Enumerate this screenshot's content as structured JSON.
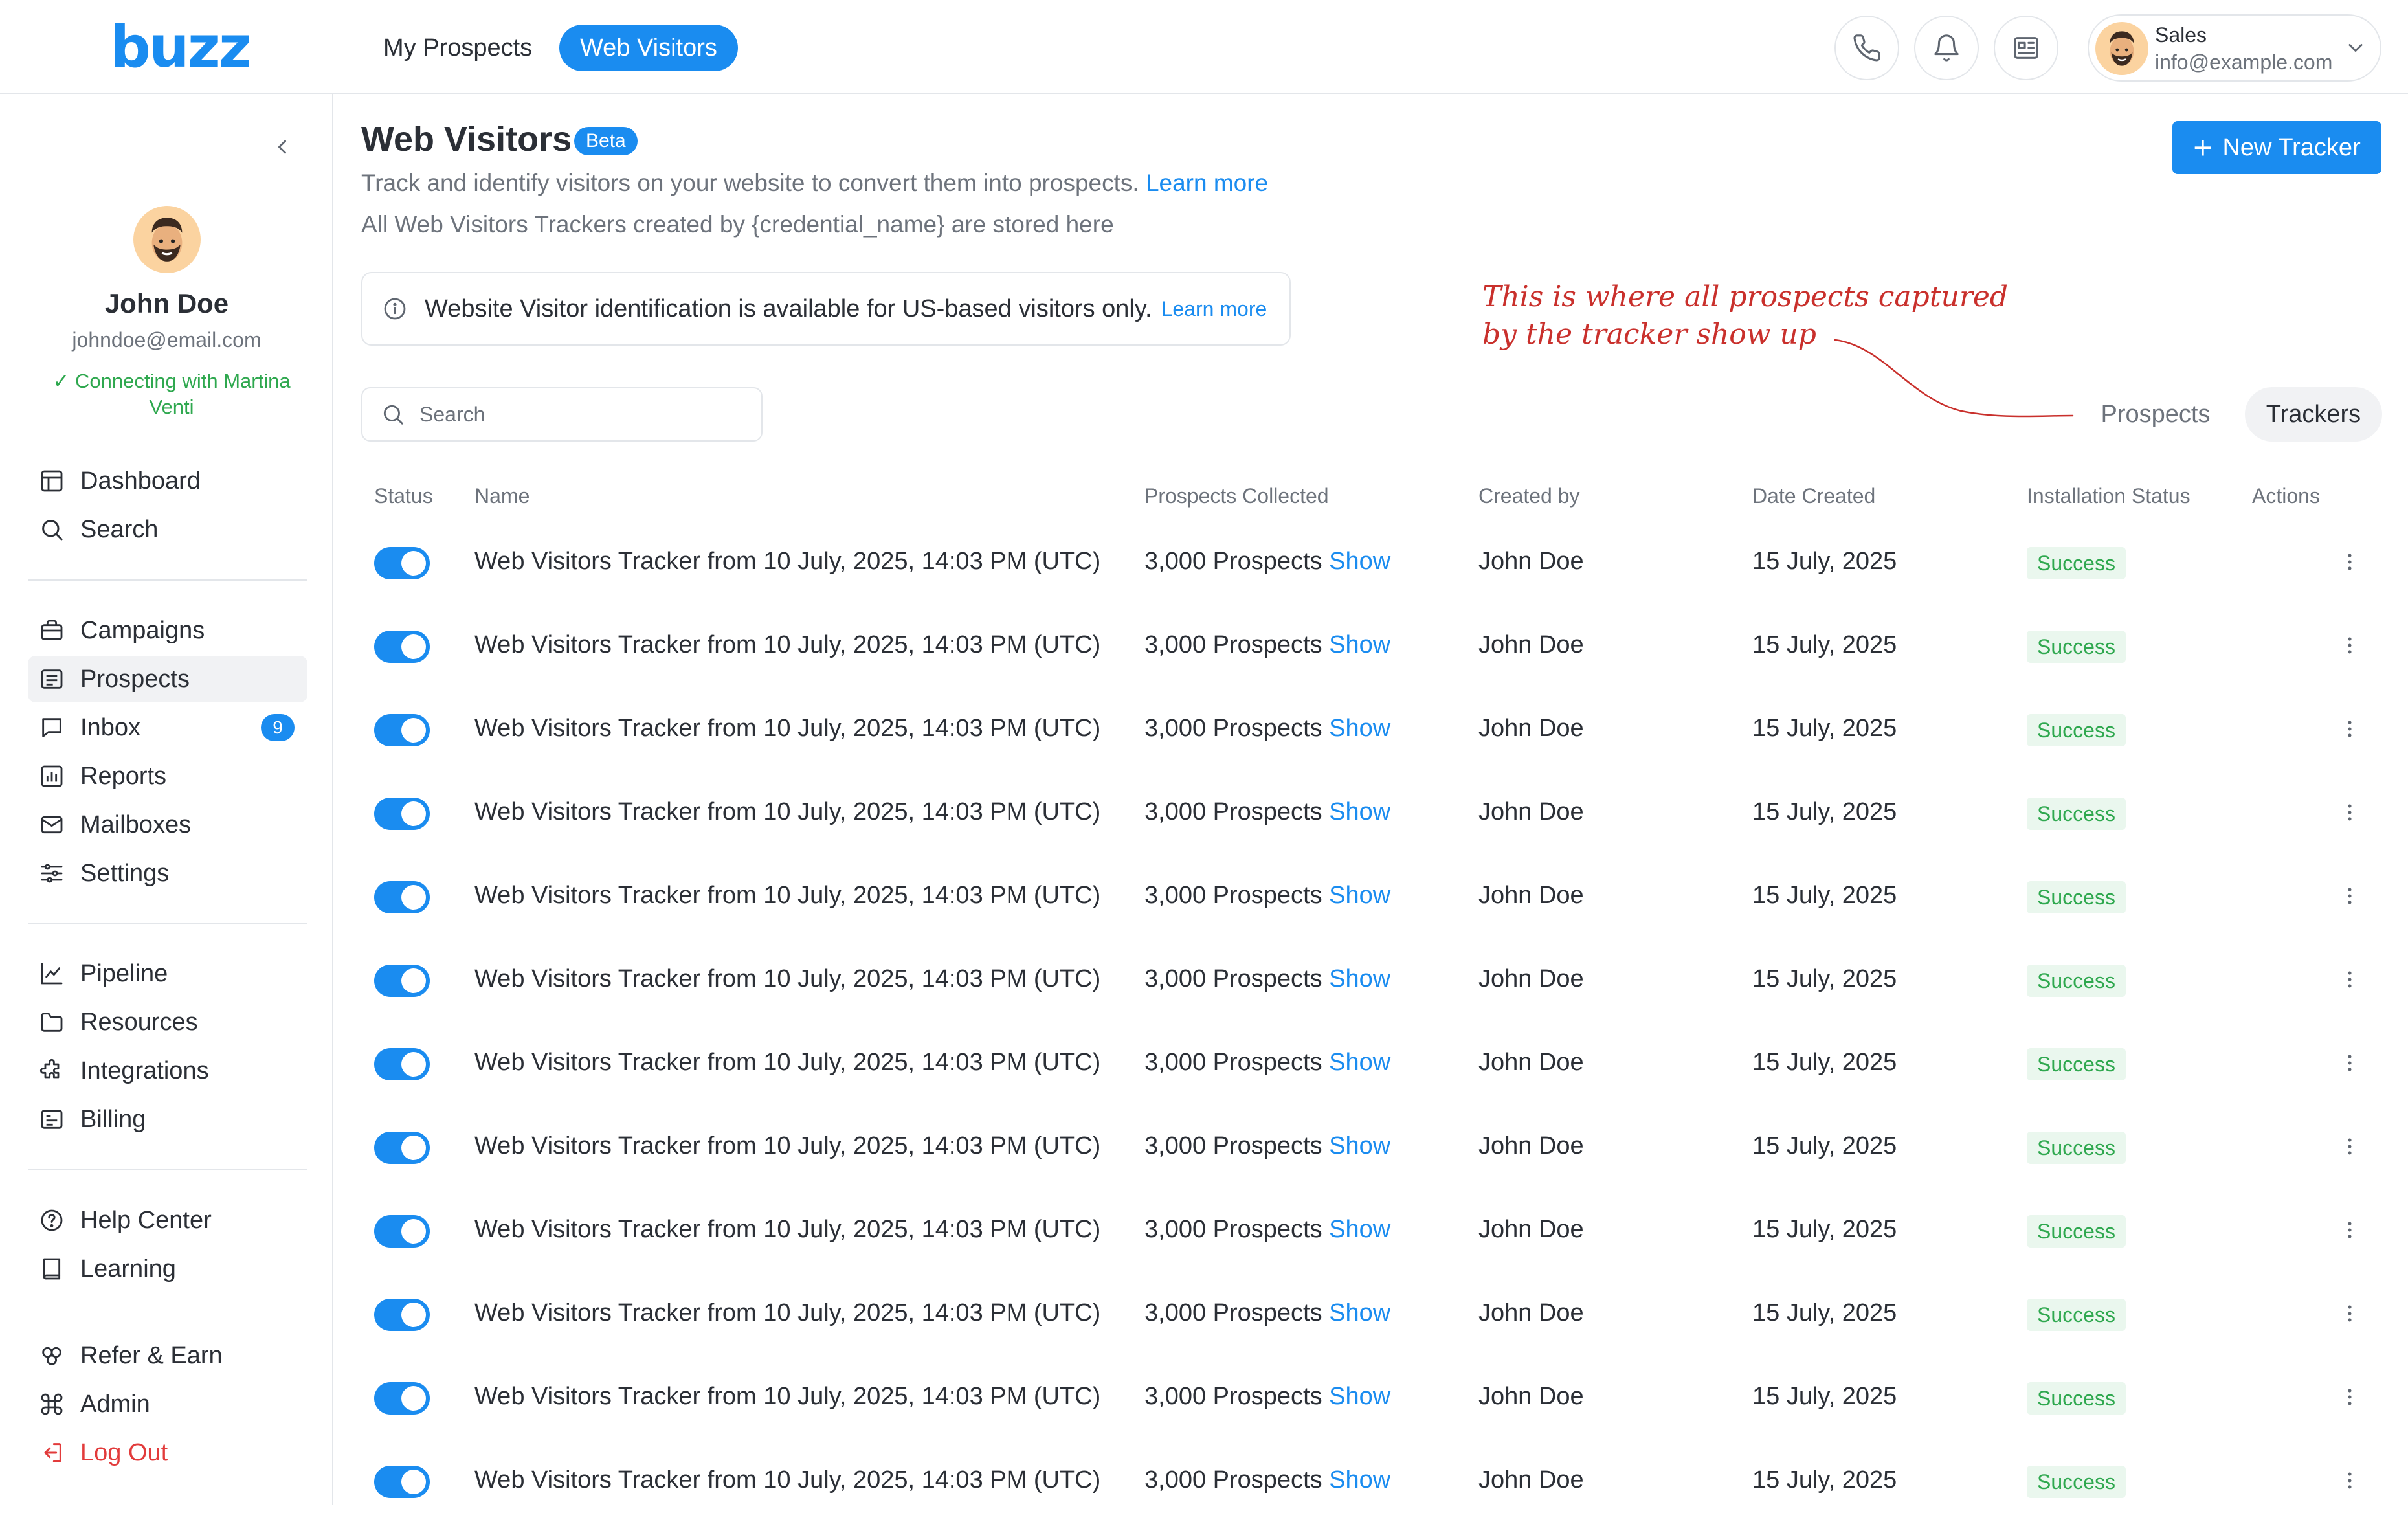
{
  "brand": {
    "logo_text": "buzz",
    "color": "#1a8cf0"
  },
  "topbar": {
    "tabs": [
      {
        "label": "My Prospects",
        "active": false
      },
      {
        "label": "Web Visitors",
        "active": true
      }
    ],
    "icons": [
      "phone-icon",
      "bell-icon",
      "newspaper-icon"
    ],
    "user": {
      "role": "Sales",
      "email": "info@example.com"
    }
  },
  "sidebar": {
    "profile": {
      "name": "John Doe",
      "email": "johndoe@email.com",
      "status": "Connecting with Martina Venti"
    },
    "groups": [
      [
        {
          "label": "Dashboard",
          "icon": "dashboard-icon"
        },
        {
          "label": "Search",
          "icon": "search-icon"
        }
      ],
      [
        {
          "label": "Campaigns",
          "icon": "briefcase-icon"
        },
        {
          "label": "Prospects",
          "icon": "list-icon",
          "active": true
        },
        {
          "label": "Inbox",
          "icon": "message-icon",
          "badge": "9"
        },
        {
          "label": "Reports",
          "icon": "bar-chart-icon"
        },
        {
          "label": "Mailboxes",
          "icon": "mail-icon"
        },
        {
          "label": "Settings",
          "icon": "sliders-icon"
        }
      ],
      [
        {
          "label": "Pipeline",
          "icon": "line-chart-icon"
        },
        {
          "label": "Resources",
          "icon": "folder-icon"
        },
        {
          "label": "Integrations",
          "icon": "puzzle-icon"
        },
        {
          "label": "Billing",
          "icon": "billing-icon"
        }
      ],
      [
        {
          "label": "Help Center",
          "icon": "help-icon"
        },
        {
          "label": "Learning",
          "icon": "book-icon"
        }
      ],
      [
        {
          "label": "Refer & Earn",
          "icon": "gift-icon"
        },
        {
          "label": "Admin",
          "icon": "command-icon"
        },
        {
          "label": "Log Out",
          "icon": "logout-icon"
        }
      ]
    ]
  },
  "main": {
    "title": "Web Visitors",
    "beta_label": "Beta",
    "subtitle": "Track and identify visitors on your website to convert them into prospects.",
    "subtitle_link": "Learn more",
    "subtitle2": "All Web Visitors Trackers created by {credential_name} are stored here",
    "new_tracker_label": "New Tracker",
    "notice": {
      "text": "Website Visitor identification is available for US-based visitors only.",
      "link": "Learn more"
    },
    "annotation": "This is where all prospects captured by the tracker show up",
    "search_placeholder": "Search",
    "segments": {
      "prospects": "Prospects",
      "trackers": "Trackers"
    },
    "table": {
      "columns": [
        "Status",
        "Name",
        "Prospects Collected",
        "Created by",
        "Date Created",
        "Installation Status",
        "Actions"
      ],
      "rows": [
        {
          "enabled": true,
          "name": "Web Visitors Tracker from 10 July, 2025, 14:03 PM (UTC)",
          "prospects": "3,000 Prospects",
          "show": "Show",
          "created_by": "John Doe",
          "date": "15 July, 2025",
          "status": "Success"
        },
        {
          "enabled": true,
          "name": "Web Visitors Tracker from 10 July, 2025, 14:03 PM (UTC)",
          "prospects": "3,000 Prospects",
          "show": "Show",
          "created_by": "John Doe",
          "date": "15 July, 2025",
          "status": "Success"
        },
        {
          "enabled": true,
          "name": "Web Visitors Tracker from 10 July, 2025, 14:03 PM (UTC)",
          "prospects": "3,000 Prospects",
          "show": "Show",
          "created_by": "John Doe",
          "date": "15 July, 2025",
          "status": "Success"
        },
        {
          "enabled": true,
          "name": "Web Visitors Tracker from 10 July, 2025, 14:03 PM (UTC)",
          "prospects": "3,000 Prospects",
          "show": "Show",
          "created_by": "John Doe",
          "date": "15 July, 2025",
          "status": "Success"
        },
        {
          "enabled": true,
          "name": "Web Visitors Tracker from 10 July, 2025, 14:03 PM (UTC)",
          "prospects": "3,000 Prospects",
          "show": "Show",
          "created_by": "John Doe",
          "date": "15 July, 2025",
          "status": "Success"
        },
        {
          "enabled": true,
          "name": "Web Visitors Tracker from 10 July, 2025, 14:03 PM (UTC)",
          "prospects": "3,000 Prospects",
          "show": "Show",
          "created_by": "John Doe",
          "date": "15 July, 2025",
          "status": "Success"
        },
        {
          "enabled": true,
          "name": "Web Visitors Tracker from 10 July, 2025, 14:03 PM (UTC)",
          "prospects": "3,000 Prospects",
          "show": "Show",
          "created_by": "John Doe",
          "date": "15 July, 2025",
          "status": "Success"
        },
        {
          "enabled": true,
          "name": "Web Visitors Tracker from 10 July, 2025, 14:03 PM (UTC)",
          "prospects": "3,000 Prospects",
          "show": "Show",
          "created_by": "John Doe",
          "date": "15 July, 2025",
          "status": "Success"
        },
        {
          "enabled": true,
          "name": "Web Visitors Tracker from 10 July, 2025, 14:03 PM (UTC)",
          "prospects": "3,000 Prospects",
          "show": "Show",
          "created_by": "John Doe",
          "date": "15 July, 2025",
          "status": "Success"
        },
        {
          "enabled": true,
          "name": "Web Visitors Tracker from 10 July, 2025, 14:03 PM (UTC)",
          "prospects": "3,000 Prospects",
          "show": "Show",
          "created_by": "John Doe",
          "date": "15 July, 2025",
          "status": "Success"
        },
        {
          "enabled": true,
          "name": "Web Visitors Tracker from 10 July, 2025, 14:03 PM (UTC)",
          "prospects": "3,000 Prospects",
          "show": "Show",
          "created_by": "John Doe",
          "date": "15 July, 2025",
          "status": "Success"
        },
        {
          "enabled": true,
          "name": "Web Visitors Tracker from 10 July, 2025, 14:03 PM (UTC)",
          "prospects": "3,000 Prospects",
          "show": "Show",
          "created_by": "John Doe",
          "date": "15 July, 2025",
          "status": "Success"
        }
      ]
    }
  }
}
